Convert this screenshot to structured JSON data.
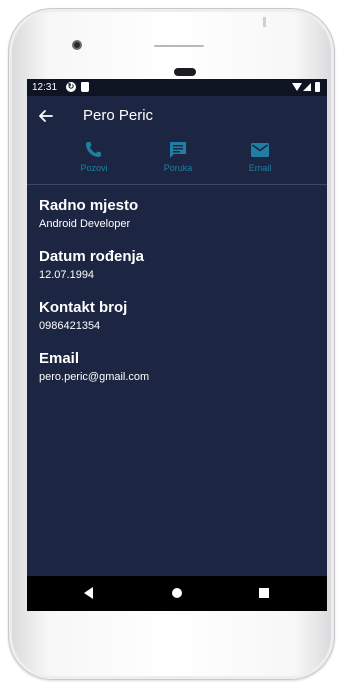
{
  "status_bar": {
    "time": "12:31",
    "icons": [
      "sync-icon",
      "sd-card-icon",
      "wifi-icon",
      "signal-icon",
      "battery-icon"
    ]
  },
  "app_bar": {
    "title": "Pero Peric",
    "back_icon": "arrow-back-icon"
  },
  "actions": [
    {
      "label": "Pozovi",
      "icon": "phone-icon"
    },
    {
      "label": "Poruka",
      "icon": "message-icon"
    },
    {
      "label": "Email",
      "icon": "mail-icon"
    }
  ],
  "details": [
    {
      "label": "Radno mjesto",
      "value": "Android Developer"
    },
    {
      "label": "Datum rođenja",
      "value": "12.07.1994"
    },
    {
      "label": "Kontakt broj",
      "value": "0986421354"
    },
    {
      "label": "Email",
      "value": "pero.peric@gmail.com"
    }
  ],
  "nav_bar": {
    "icons": [
      "nav-back-icon",
      "nav-home-icon",
      "nav-recents-icon"
    ]
  },
  "colors": {
    "background": "#1c2541",
    "status_bar": "#0f1423",
    "accent": "#1e7fa3",
    "divider": "#3e4762",
    "text": "#ffffff",
    "nav_bar": "#000000"
  }
}
